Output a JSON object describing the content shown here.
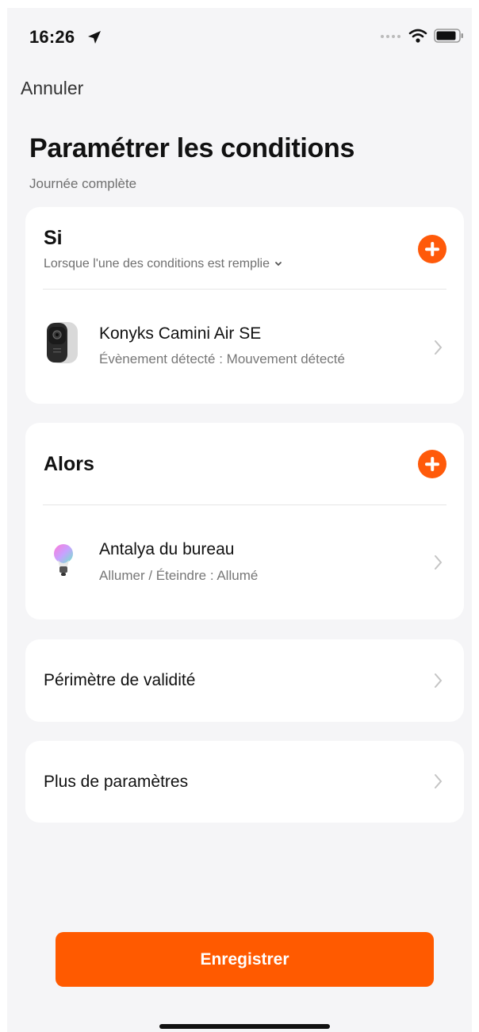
{
  "status_bar": {
    "time": "16:26"
  },
  "nav": {
    "cancel_label": "Annuler"
  },
  "header": {
    "title": "Paramétrer les conditions",
    "subtitle": "Journée complète"
  },
  "if_card": {
    "title": "Si",
    "condition_mode": "Lorsque l'une des conditions est remplie",
    "device": {
      "name": "Konyks Camini Air SE",
      "detail": "Évènement détecté : Mouvement détecté"
    }
  },
  "then_card": {
    "title": "Alors",
    "device": {
      "name": "Antalya du bureau",
      "detail": "Allumer / Éteindre : Allumé"
    }
  },
  "validity_row": {
    "label": "Périmètre de validité"
  },
  "more_row": {
    "label": "Plus de paramètres"
  },
  "footer": {
    "save_label": "Enregistrer"
  },
  "colors": {
    "accent": "#ff5a00",
    "background": "#f5f5f7",
    "card": "#ffffff",
    "secondary_text": "#6f6f6f"
  },
  "icons": {
    "location": "location-arrow-icon",
    "signal": "signal-dots-icon",
    "wifi": "wifi-icon",
    "battery": "battery-icon",
    "add": "plus-circle-icon",
    "chevron": "chevron-right-icon",
    "dropdown": "chevron-down-icon",
    "camera": "camera-device-icon",
    "bulb": "bulb-device-icon"
  }
}
